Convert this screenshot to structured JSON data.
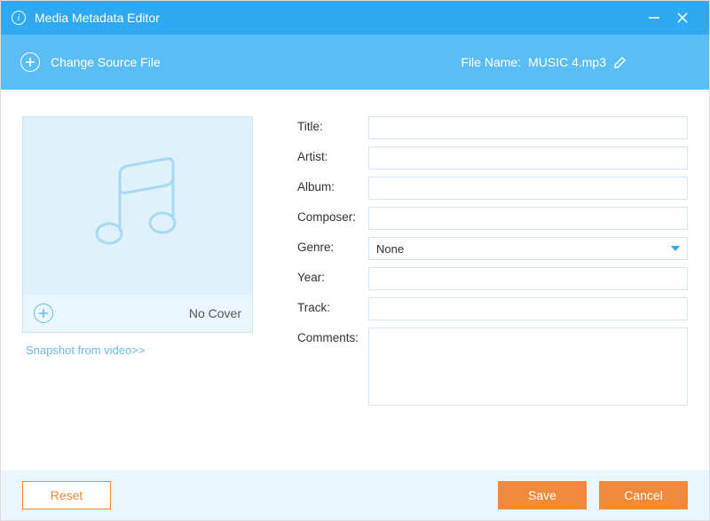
{
  "window": {
    "title": "Media Metadata Editor"
  },
  "toolbar": {
    "change_source_label": "Change Source File",
    "file_name_label": "File Name:",
    "file_name_value": "MUSIC 4.mp3"
  },
  "cover": {
    "no_cover_label": "No Cover",
    "snapshot_link": "Snapshot from video>>"
  },
  "form": {
    "title": {
      "label": "Title:",
      "value": ""
    },
    "artist": {
      "label": "Artist:",
      "value": ""
    },
    "album": {
      "label": "Album:",
      "value": ""
    },
    "composer": {
      "label": "Composer:",
      "value": ""
    },
    "genre": {
      "label": "Genre:",
      "value": "None"
    },
    "year": {
      "label": "Year:",
      "value": ""
    },
    "track": {
      "label": "Track:",
      "value": ""
    },
    "comments": {
      "label": "Comments:",
      "value": ""
    }
  },
  "footer": {
    "reset_label": "Reset",
    "save_label": "Save",
    "cancel_label": "Cancel"
  },
  "colors": {
    "titlebar": "#2fa9f1",
    "toolbar": "#5bbdf5",
    "accent": "#f28a3c",
    "border": "#cfe8f7",
    "panel": "#eaf6fd"
  }
}
